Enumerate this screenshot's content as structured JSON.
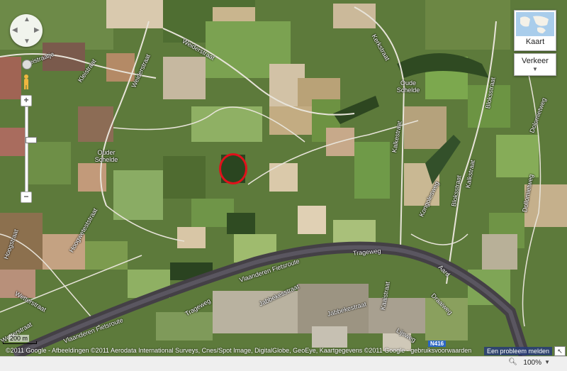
{
  "map": {
    "labels": [
      {
        "text": "Kleistraatje"
      },
      {
        "text": "Kleistraat"
      },
      {
        "text": "Weiderstraat"
      },
      {
        "text": "Weiderstraat"
      },
      {
        "text": "Kerkstraat"
      },
      {
        "text": "Oude Schelde"
      },
      {
        "text": "Ouder Schelde"
      },
      {
        "text": "Kalkestraat"
      },
      {
        "text": "Bloksstraat"
      },
      {
        "text": "Dolomietweg"
      },
      {
        "text": "Hoogstraat"
      },
      {
        "text": "Hoogweteststraat"
      },
      {
        "text": "Wetterstraat"
      },
      {
        "text": "Wetterstraat"
      },
      {
        "text": "Trageweg"
      },
      {
        "text": "Trageweg"
      },
      {
        "text": "Vlaanderen Fietsroute"
      },
      {
        "text": "Vlaanderen Fietsroute"
      },
      {
        "text": "Jabbekesstraat"
      },
      {
        "text": "Jabbekestraat"
      },
      {
        "text": "Kongolesweg"
      },
      {
        "text": "Bloksstraat"
      },
      {
        "text": "Kalkstraat"
      },
      {
        "text": "Dollomietweg"
      },
      {
        "text": "Aard"
      },
      {
        "text": "Draaiweg"
      },
      {
        "text": "Lijsweg"
      },
      {
        "text": "Kaaistraat"
      }
    ],
    "shield": "N416"
  },
  "controls": {
    "map_type_label": "Kaart",
    "traffic_label": "Verkeer",
    "zoom_in": "+",
    "zoom_out": "−"
  },
  "footer": {
    "scale": "200 m",
    "copyright": "©2011 Google - Afbeeldingen ©2011 Aerodata International Surveys, Cnes/Spot Image, DigitalGlobe, GeoEye, Kaartgegevens ©2011 Google - gebruiksvoorwaarden",
    "report_problem": "Een probleem melden"
  },
  "statusbar": {
    "zoom": "100%"
  },
  "colors": {
    "highlight": "#e0101a",
    "water": "#4a4a50"
  }
}
